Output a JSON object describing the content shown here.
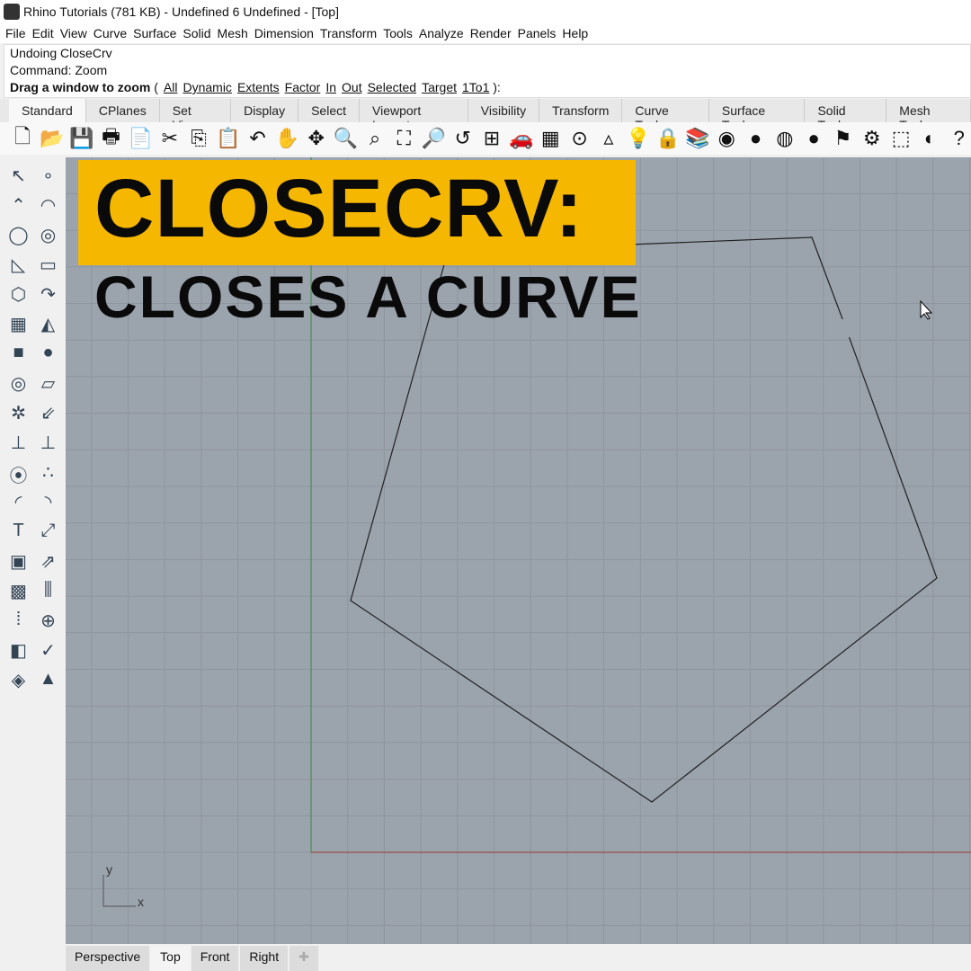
{
  "window": {
    "title": "Rhino Tutorials (781 KB) - Undefined 6 Undefined - [Top]"
  },
  "menu": [
    "File",
    "Edit",
    "View",
    "Curve",
    "Surface",
    "Solid",
    "Mesh",
    "Dimension",
    "Transform",
    "Tools",
    "Analyze",
    "Render",
    "Panels",
    "Help"
  ],
  "command": {
    "history": [
      "Undoing CloseCrv",
      "Command: Zoom"
    ],
    "prompt": "Drag a window to zoom",
    "options": [
      "All",
      "Dynamic",
      "Extents",
      "Factor",
      "In",
      "Out",
      "Selected",
      "Target",
      "1To1"
    ]
  },
  "toolbar_tabs": [
    "Standard",
    "CPlanes",
    "Set View",
    "Display",
    "Select",
    "Viewport Layout",
    "Visibility",
    "Transform",
    "Curve Tools",
    "Surface Tools",
    "Solid Tools",
    "Mesh Tools"
  ],
  "toolbar_icons": [
    "new-icon",
    "open-icon",
    "save-icon",
    "print-icon",
    "import-icon",
    "cut-icon",
    "copy-icon",
    "paste-icon",
    "undo-icon",
    "pan-icon",
    "rotate-icon",
    "zoom-icon",
    "zoom-window-icon",
    "zoom-extents-icon",
    "zoom-selected-icon",
    "undo-view-icon",
    "viewports-icon",
    "car-icon",
    "grid-icon",
    "point-icon",
    "shapes-icon",
    "light-icon",
    "lock-icon",
    "layer-icon",
    "color-icon",
    "sphere-icon",
    "sphere-grid-icon",
    "blue-sphere-icon",
    "select-icon",
    "gear-icon",
    "box-icon",
    "globe-icon",
    "help-icon"
  ],
  "overlay": {
    "title": "CLOSECRV:",
    "subtitle": "CLOSES A CURVE",
    "accent": "#f6b700"
  },
  "axes": {
    "y": "y",
    "x": "x"
  },
  "viewport_tabs": [
    "Perspective",
    "Top",
    "Front",
    "Right"
  ],
  "active_viewport": "Top"
}
